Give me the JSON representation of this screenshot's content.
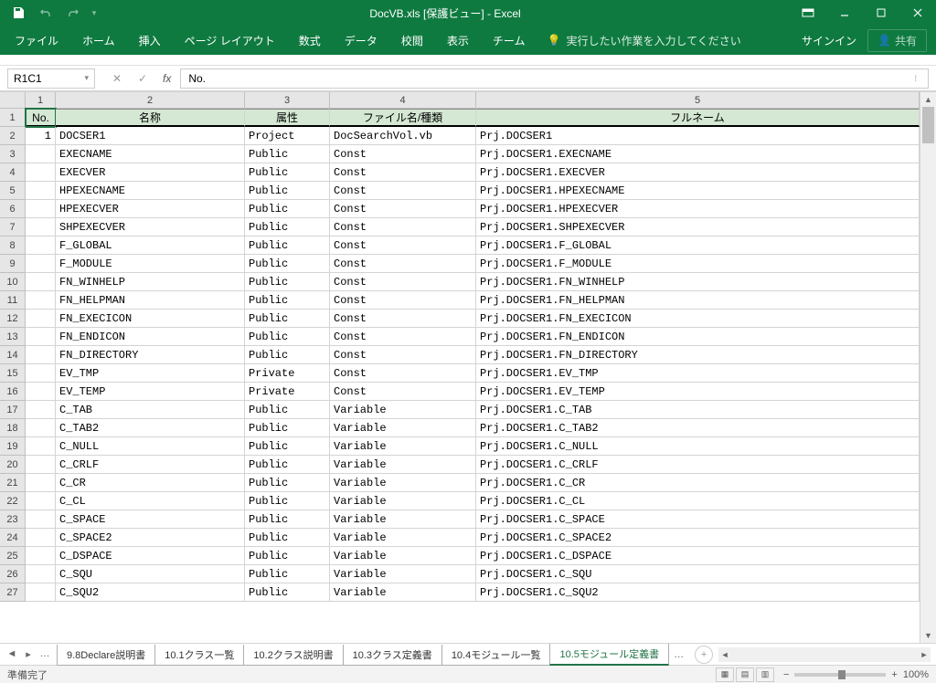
{
  "title": "DocVB.xls [保護ビュー] - Excel",
  "qat": {
    "save": "保存",
    "undo": "元に戻す",
    "redo": "やり直し"
  },
  "ribbon": {
    "tabs": [
      "ファイル",
      "ホーム",
      "挿入",
      "ページ レイアウト",
      "数式",
      "データ",
      "校閲",
      "表示",
      "チーム"
    ],
    "tellme": "実行したい作業を入力してください",
    "signin": "サインイン",
    "share": "共有"
  },
  "namebox": "R1C1",
  "formula_value": "No.",
  "col_numbers": [
    "1",
    "2",
    "3",
    "4",
    "5"
  ],
  "headers": {
    "no": "No.",
    "name": "名称",
    "attr": "属性",
    "filetype": "ファイル名/種類",
    "fullname": "フルネーム"
  },
  "rows": [
    {
      "n": "1",
      "name": "DOCSER1",
      "attr": "Project",
      "ft": "DocSearchVol.vb",
      "fn": "Prj.DOCSER1"
    },
    {
      "n": "",
      "name": "EXECNAME",
      "attr": "Public",
      "ft": "Const",
      "fn": "Prj.DOCSER1.EXECNAME"
    },
    {
      "n": "",
      "name": "EXECVER",
      "attr": "Public",
      "ft": "Const",
      "fn": "Prj.DOCSER1.EXECVER"
    },
    {
      "n": "",
      "name": "HPEXECNAME",
      "attr": "Public",
      "ft": "Const",
      "fn": "Prj.DOCSER1.HPEXECNAME"
    },
    {
      "n": "",
      "name": "HPEXECVER",
      "attr": "Public",
      "ft": "Const",
      "fn": "Prj.DOCSER1.HPEXECVER"
    },
    {
      "n": "",
      "name": "SHPEXECVER",
      "attr": "Public",
      "ft": "Const",
      "fn": "Prj.DOCSER1.SHPEXECVER"
    },
    {
      "n": "",
      "name": "F_GLOBAL",
      "attr": "Public",
      "ft": "Const",
      "fn": "Prj.DOCSER1.F_GLOBAL"
    },
    {
      "n": "",
      "name": "F_MODULE",
      "attr": "Public",
      "ft": "Const",
      "fn": "Prj.DOCSER1.F_MODULE"
    },
    {
      "n": "",
      "name": "FN_WINHELP",
      "attr": "Public",
      "ft": "Const",
      "fn": "Prj.DOCSER1.FN_WINHELP"
    },
    {
      "n": "",
      "name": "FN_HELPMAN",
      "attr": "Public",
      "ft": "Const",
      "fn": "Prj.DOCSER1.FN_HELPMAN"
    },
    {
      "n": "",
      "name": "FN_EXECICON",
      "attr": "Public",
      "ft": "Const",
      "fn": "Prj.DOCSER1.FN_EXECICON"
    },
    {
      "n": "",
      "name": "FN_ENDICON",
      "attr": "Public",
      "ft": "Const",
      "fn": "Prj.DOCSER1.FN_ENDICON"
    },
    {
      "n": "",
      "name": "FN_DIRECTORY",
      "attr": "Public",
      "ft": "Const",
      "fn": "Prj.DOCSER1.FN_DIRECTORY"
    },
    {
      "n": "",
      "name": "EV_TMP",
      "attr": "Private",
      "ft": "Const",
      "fn": "Prj.DOCSER1.EV_TMP"
    },
    {
      "n": "",
      "name": "EV_TEMP",
      "attr": "Private",
      "ft": "Const",
      "fn": "Prj.DOCSER1.EV_TEMP"
    },
    {
      "n": "",
      "name": "C_TAB",
      "attr": "Public",
      "ft": "Variable",
      "fn": "Prj.DOCSER1.C_TAB"
    },
    {
      "n": "",
      "name": "C_TAB2",
      "attr": "Public",
      "ft": "Variable",
      "fn": "Prj.DOCSER1.C_TAB2"
    },
    {
      "n": "",
      "name": "C_NULL",
      "attr": "Public",
      "ft": "Variable",
      "fn": "Prj.DOCSER1.C_NULL"
    },
    {
      "n": "",
      "name": "C_CRLF",
      "attr": "Public",
      "ft": "Variable",
      "fn": "Prj.DOCSER1.C_CRLF"
    },
    {
      "n": "",
      "name": "C_CR",
      "attr": "Public",
      "ft": "Variable",
      "fn": "Prj.DOCSER1.C_CR"
    },
    {
      "n": "",
      "name": "C_CL",
      "attr": "Public",
      "ft": "Variable",
      "fn": "Prj.DOCSER1.C_CL"
    },
    {
      "n": "",
      "name": "C_SPACE",
      "attr": "Public",
      "ft": "Variable",
      "fn": "Prj.DOCSER1.C_SPACE"
    },
    {
      "n": "",
      "name": "C_SPACE2",
      "attr": "Public",
      "ft": "Variable",
      "fn": "Prj.DOCSER1.C_SPACE2"
    },
    {
      "n": "",
      "name": "C_DSPACE",
      "attr": "Public",
      "ft": "Variable",
      "fn": "Prj.DOCSER1.C_DSPACE"
    },
    {
      "n": "",
      "name": "C_SQU",
      "attr": "Public",
      "ft": "Variable",
      "fn": "Prj.DOCSER1.C_SQU"
    },
    {
      "n": "",
      "name": "C_SQU2",
      "attr": "Public",
      "ft": "Variable",
      "fn": "Prj.DOCSER1.C_SQU2"
    }
  ],
  "sheet_tabs": [
    "9.8Declare説明書",
    "10.1クラス一覧",
    "10.2クラス説明書",
    "10.3クラス定義書",
    "10.4モジュール一覧",
    "10.5モジュール定義書"
  ],
  "sheet_active": 5,
  "status": {
    "ready": "準備完了",
    "zoom": "100%"
  }
}
